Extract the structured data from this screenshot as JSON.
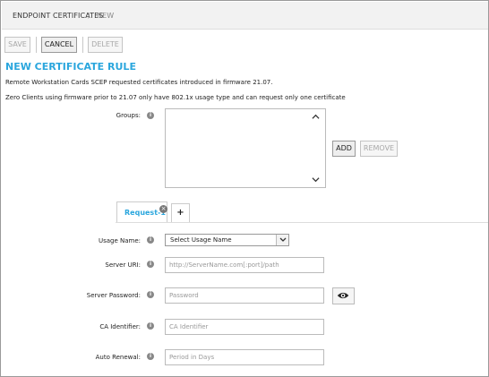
{
  "breadcrumb": {
    "parent": "ENDPOINT CERTIFICATES",
    "separator": "/",
    "current": "NEW"
  },
  "toolbar": {
    "save_label": "SAVE",
    "cancel_label": "CANCEL",
    "delete_label": "DELETE"
  },
  "page": {
    "title": "NEW CERTIFICATE RULE",
    "info_1": "Remote Workstation Cards SCEP requested certificates introduced in firmware 21.07.",
    "info_2": "Zero Clients using firmware prior to 21.07 only have 802.1x usage type and can request only one certificate"
  },
  "groups": {
    "label": "Groups:",
    "add_label": "ADD",
    "remove_label": "REMOVE"
  },
  "tabs": {
    "request_label": "Request-1",
    "add_tab_label": "+"
  },
  "form": {
    "usage_name": {
      "label": "Usage Name:",
      "value": "Select Usage Name"
    },
    "server_uri": {
      "label": "Server URI:",
      "placeholder": "http://ServerName.com[:port]/path"
    },
    "server_password": {
      "label": "Server Password:",
      "placeholder": "Password"
    },
    "ca_identifier": {
      "label": "CA Identifier:",
      "placeholder": "CA Identifier"
    },
    "auto_renewal": {
      "label": "Auto Renewal:",
      "placeholder": "Period in Days"
    }
  },
  "icons": {
    "help": "info-circle-icon",
    "close_tab": "close-icon",
    "dropdown": "chevron-down-icon",
    "show_password": "eye-icon",
    "scroll_up": "chevron-up-icon",
    "scroll_down": "chevron-down-icon"
  },
  "colors": {
    "accent": "#2aa6dd",
    "topbar": "#f2f2f2"
  }
}
